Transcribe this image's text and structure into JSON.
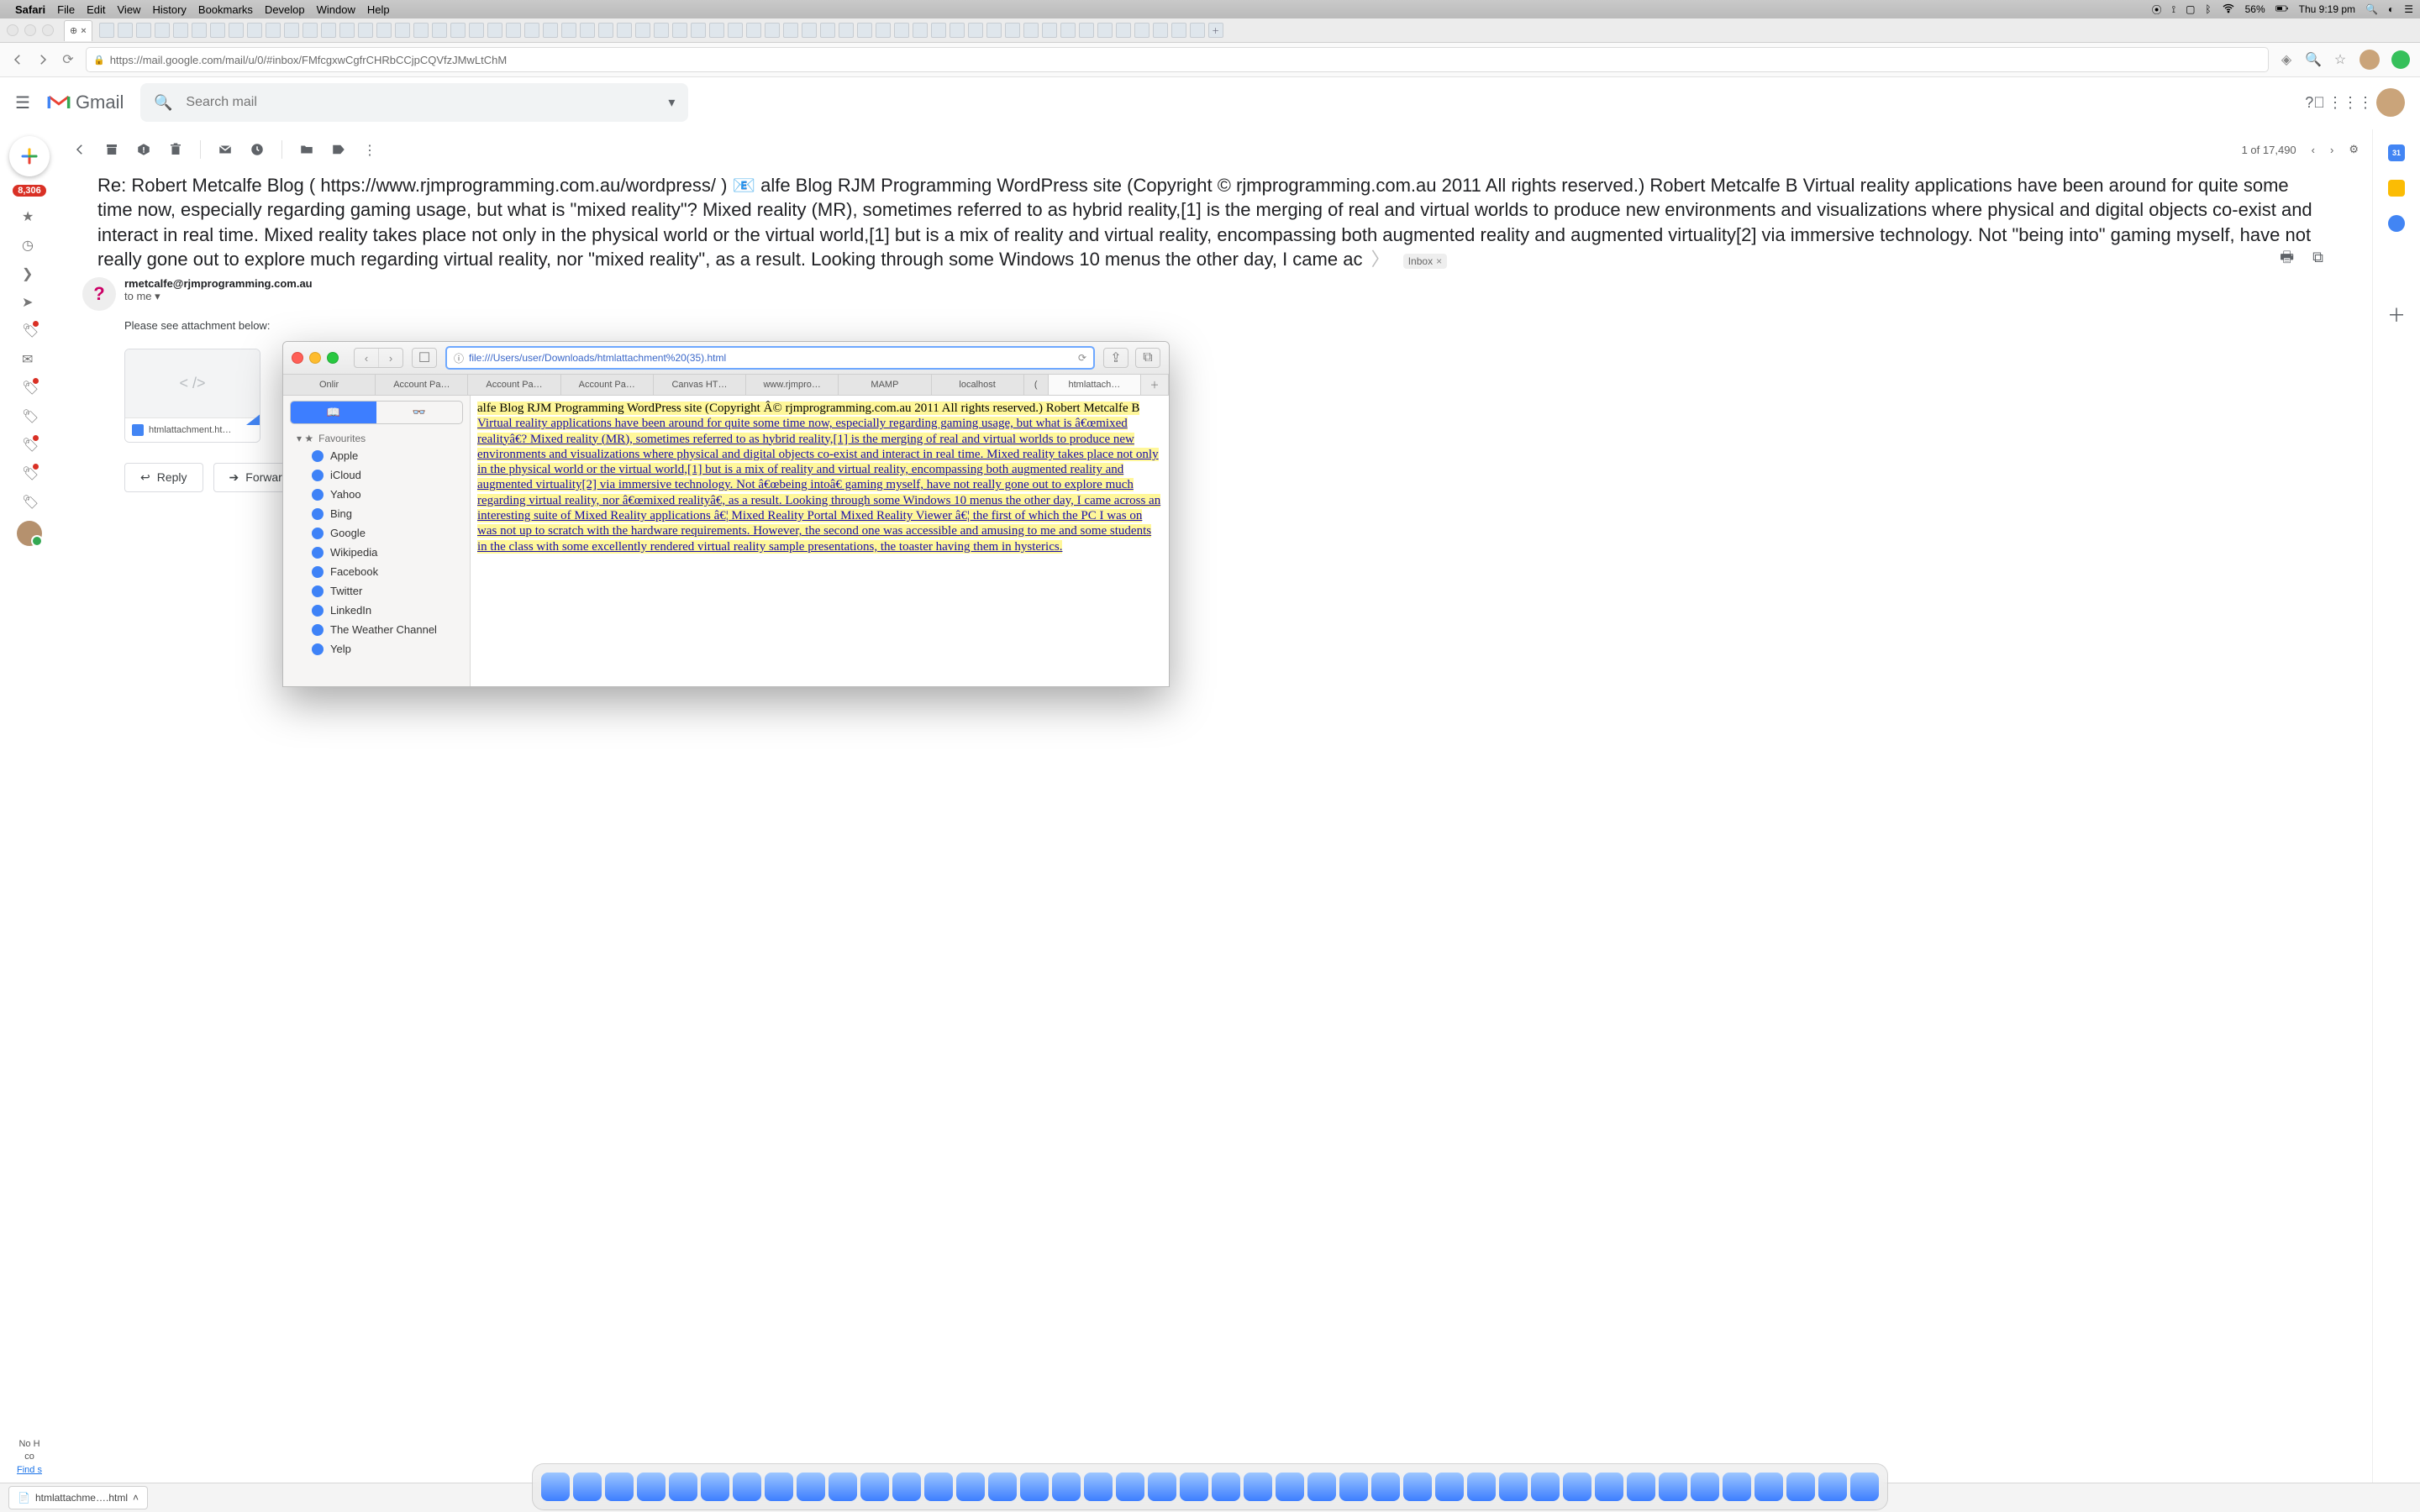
{
  "mac_menu": {
    "app": "Safari",
    "items": [
      "File",
      "Edit",
      "View",
      "History",
      "Bookmarks",
      "Develop",
      "Window",
      "Help"
    ],
    "battery": "56%",
    "clock": "Thu 9:19 pm"
  },
  "safari": {
    "active_tab": "",
    "url": "https://mail.google.com/mail/u/0/#inbox/FMfcgxwCgfrCHRbCCjpCQVfzJMwLtChM"
  },
  "gmail": {
    "product": "Gmail",
    "search_placeholder": "Search mail",
    "inbox_badge": "8,306",
    "pager": "1 of 17,490",
    "subject_full": "Re: Robert Metcalfe Blog ( https://www.rjmprogramming.com.au/wordpress/ )   📧      alfe Blog RJM Programming WordPress site (Copyright © rjmprogramming.com.au 2011 All rights reserved.) Robert Metcalfe B Virtual reality applications have been around for quite some time now, especially regarding gaming usage, but what is \"mixed reality\"? Mixed reality (MR), sometimes referred to as hybrid reality,[1] is the merging of real and virtual worlds to produce new environments and visualizations where physical and digital objects co-exist and interact in real time. Mixed reality takes place not only in the physical world or the virtual world,[1] but is a mix of reality and virtual reality, encompassing both augmented reality and augmented virtuality[2] via immersive technology. Not \"being into\" gaming myself, have not really gone out to explore much regarding virtual reality, nor \"mixed reality\", as a result. Looking through some Windows 10 menus the other day, I came ac",
    "chip_label": "Inbox",
    "sender_address": "rmetcalfe@rjmprogramming.com.au",
    "sender_to": "to me",
    "body_text": "Please see attachment below:",
    "attachment_name": "htmlattachment.ht…",
    "reply_label": "Reply",
    "forward_label": "Forward",
    "left_bottom_1": "No H",
    "left_bottom_2": "co",
    "left_bottom_3": "Find s"
  },
  "float": {
    "url": "file:///Users/user/Downloads/htmlattachment%20(35).html",
    "tabs": [
      "Onlir",
      "Account Pa…",
      "Account Pa…",
      "Account Pa…",
      "Canvas HT…",
      "www.rjmpro…",
      "MAMP",
      "localhost",
      "(",
      "htmlattach…"
    ],
    "section": "Favourites",
    "favourites": [
      "Apple",
      "iCloud",
      "Yahoo",
      "Bing",
      "Google",
      "Wikipedia",
      "Facebook",
      "Twitter",
      "LinkedIn",
      "The Weather Channel",
      "Yelp"
    ],
    "highlight_lead": "  alfe Blog RJM Programming WordPress site (Copyright Â© rjmprogramming.com.au 2011 All rights reserved.) Robert Metcalfe B ",
    "highlight_link": "Virtual reality applications have been around for quite some time now, especially regarding gaming usage, but what is â€œmixed realityâ€? Mixed reality (MR), sometimes referred to as hybrid reality,[1] is the merging of real and virtual worlds to produce new environments and visualizations where physical and digital objects co-exist and interact in real time. Mixed reality takes place not only in the physical world or the virtual world,[1] but is a mix of reality and virtual reality, encompassing both augmented reality and augmented virtuality[2] via immersive technology. Not â€œbeing intoâ€ gaming myself, have not really gone out to explore much regarding virtual reality, nor â€œmixed realityâ€, as a result. Looking through some Windows 10 menus the other day, I came across an interesting suite of Mixed Reality applications â€¦ Mixed Reality Portal Mixed Reality Viewer â€¦ the first of which the PC I was on was not up to scratch with the hardware requirements. However, the second one was accessible and amusing to me and some students in the class with some excellently rendered virtual reality sample presentations, the toaster having them in hysterics."
  },
  "downloads": {
    "item": "htmlattachme….html"
  }
}
